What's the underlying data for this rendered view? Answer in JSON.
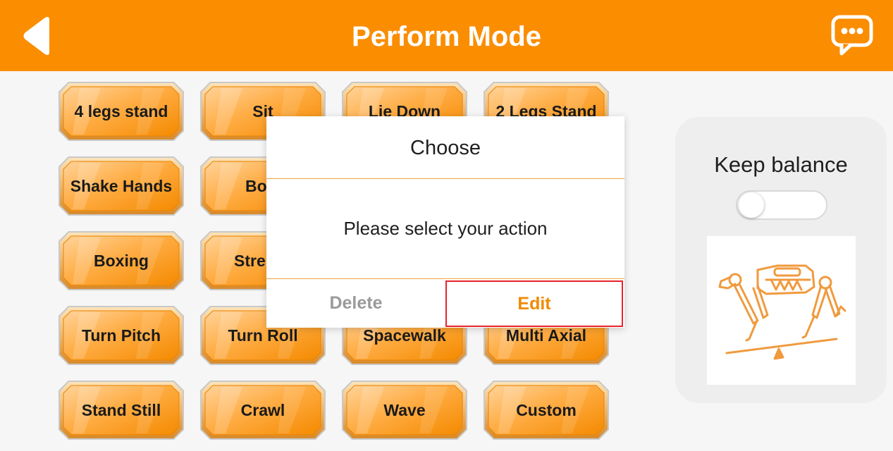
{
  "header": {
    "title": "Perform Mode",
    "back_icon": "back-arrow-icon",
    "chat_icon": "chat-bubble-icon",
    "color": "#fb8d00"
  },
  "actions": {
    "four_legs_stand": "4 legs stand",
    "sit": "Sit",
    "lie_down": "Lie Down",
    "two_legs_stand": "2 Legs Stand",
    "shake_hands": "Shake Hands",
    "bow": "Bo",
    "boxing": "Boxing",
    "stretch": "Stre",
    "turn_pitch": "Turn Pitch",
    "turn_roll": "Turn Roll",
    "spacewalk": "Spacewalk",
    "multi_axial": "Multi Axial",
    "stand_still": "Stand Still",
    "crawl": "Crawl",
    "wave": "Wave",
    "custom": "Custom"
  },
  "balance": {
    "label": "Keep balance",
    "enabled": false,
    "image_icon": "robot-dog-balance-icon"
  },
  "dialog": {
    "title": "Choose",
    "message": "Please select your action",
    "delete_label": "Delete",
    "edit_label": "Edit"
  }
}
